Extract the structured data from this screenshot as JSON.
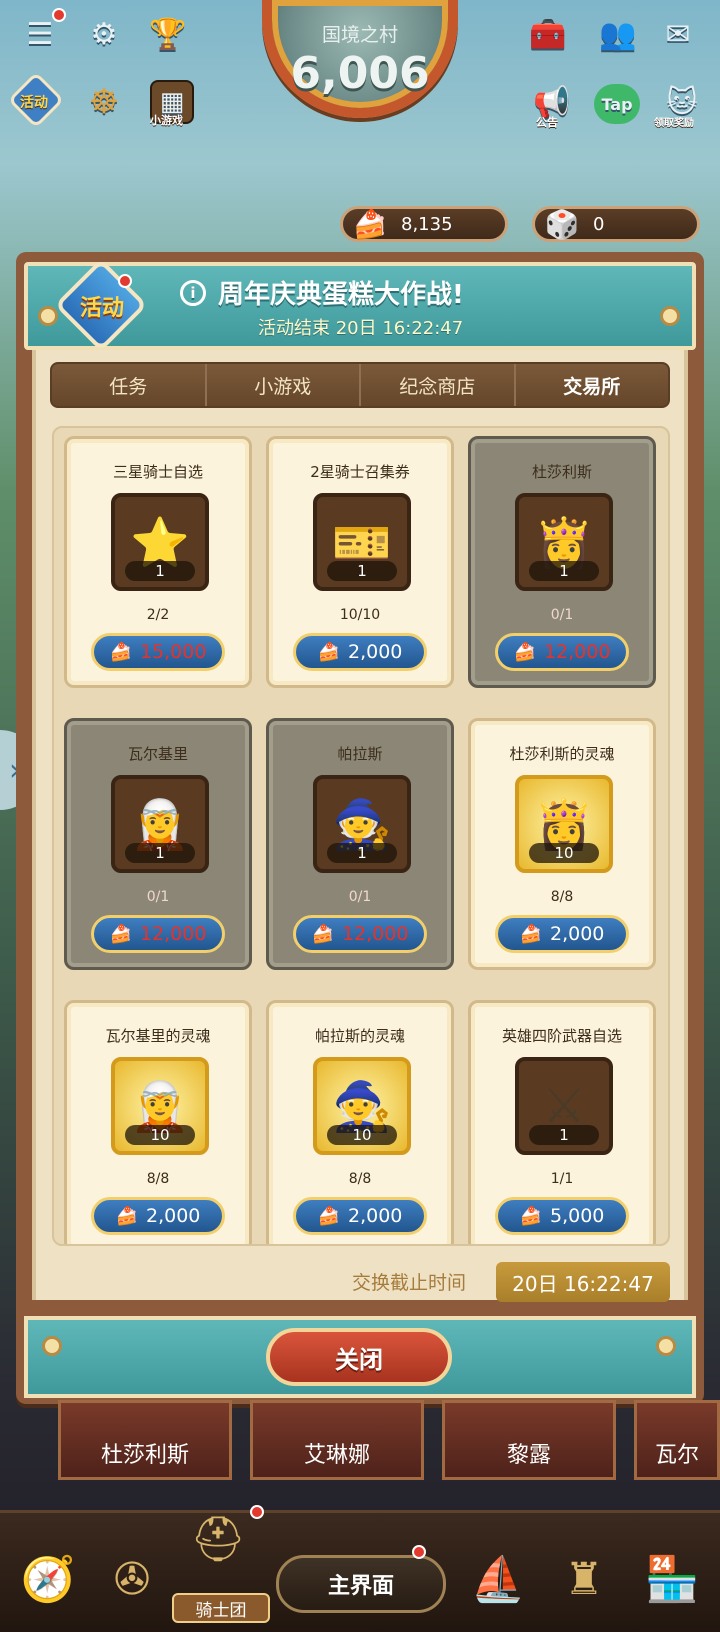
{
  "hud": {
    "score_title": "国境之村",
    "score_value": "6,006",
    "activity_label": "活动",
    "mini_games_label": "小游戏",
    "notice_label": "公告",
    "tap_label": "Tap",
    "gift_label": "领取奖励",
    "currency_cake": "8,135",
    "currency_dice": "0"
  },
  "panel": {
    "badge_label": "活动",
    "info_symbol": "i",
    "title": "周年庆典蛋糕大作战!",
    "subtitle": "活动结束 20日 16:22:47",
    "tabs": [
      "任务",
      "小游戏",
      "纪念商店",
      "交易所"
    ],
    "active_tab": "交易所",
    "cards": [
      {
        "title": "三星骑士自选",
        "icon": "⭐",
        "qty": "1",
        "count": "2/2",
        "price": "15,000",
        "affordable": false,
        "dim": false,
        "gold": false
      },
      {
        "title": "2星骑士召集券",
        "icon": "🎫",
        "qty": "1",
        "count": "10/10",
        "price": "2,000",
        "affordable": true,
        "dim": false,
        "gold": false
      },
      {
        "title": "杜莎利斯",
        "icon": "👸",
        "qty": "1",
        "count": "0/1",
        "price": "12,000",
        "affordable": false,
        "dim": true,
        "gold": false
      },
      {
        "title": "瓦尔基里",
        "icon": "🧝",
        "qty": "1",
        "count": "0/1",
        "price": "12,000",
        "affordable": false,
        "dim": true,
        "gold": false
      },
      {
        "title": "帕拉斯",
        "icon": "🧙",
        "qty": "1",
        "count": "0/1",
        "price": "12,000",
        "affordable": false,
        "dim": true,
        "gold": false
      },
      {
        "title": "杜莎利斯的灵魂",
        "icon": "👸",
        "qty": "10",
        "count": "8/8",
        "price": "2,000",
        "affordable": true,
        "dim": false,
        "gold": true
      },
      {
        "title": "瓦尔基里的灵魂",
        "icon": "🧝",
        "qty": "10",
        "count": "8/8",
        "price": "2,000",
        "affordable": true,
        "dim": false,
        "gold": true
      },
      {
        "title": "帕拉斯的灵魂",
        "icon": "🧙",
        "qty": "10",
        "count": "8/8",
        "price": "2,000",
        "affordable": true,
        "dim": false,
        "gold": true
      },
      {
        "title": "英雄四阶武器自选",
        "icon": "⚔",
        "qty": "1",
        "count": "1/1",
        "price": "5,000",
        "affordable": true,
        "dim": false,
        "gold": false
      }
    ],
    "deadline_label": "交换截止时间",
    "deadline_value": "20日 16:22:47",
    "close_label": "关闭"
  },
  "heroes": [
    "杜莎利斯",
    "艾琳娜",
    "黎露",
    "瓦尔"
  ],
  "nav": {
    "main_label": "主界面",
    "knight_label": "骑士团"
  },
  "colors": {
    "teal_header": "#4fa9aa",
    "panel_brown": "#8d5a3b",
    "price_blue": "#2f6aa8",
    "price_red": "#e7322b",
    "gold_deadline": "#b88c32"
  }
}
